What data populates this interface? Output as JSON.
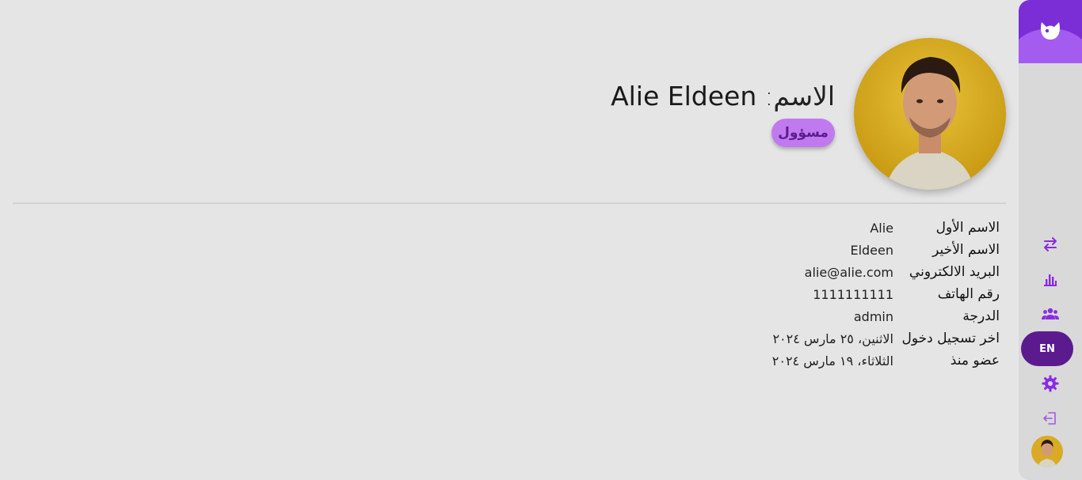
{
  "profile": {
    "name_label": "الاسم:",
    "name_value": "Alie Eldeen",
    "role_badge": "مسؤول"
  },
  "details": [
    {
      "label": "الاسم الأول",
      "value": "Alie"
    },
    {
      "label": "الاسم الأخير",
      "value": "Eldeen"
    },
    {
      "label": "البريد الالكتروني",
      "value": "alie@alie.com"
    },
    {
      "label": "رقم الهاتف",
      "value": "1111111111"
    },
    {
      "label": "الدرجة",
      "value": "admin"
    },
    {
      "label": "اخر تسجيل دخول",
      "value": "الاثنين، ٢٥ مارس ٢٠٢٤"
    },
    {
      "label": "عضو منذ",
      "value": "الثلاثاء، ١٩ مارس ٢٠٢٤"
    }
  ],
  "sidebar": {
    "language_button": "EN",
    "icons": [
      "logo-icon",
      "transfer-icon",
      "chart-icon",
      "users-icon",
      "settings-icon",
      "logout-icon"
    ]
  },
  "colors": {
    "accent": "#7b2ed6",
    "accent_light": "#c079ef",
    "accent_dark": "#5b1b8f",
    "background": "#e5e5e5",
    "sidebar": "#d9d9d9"
  }
}
